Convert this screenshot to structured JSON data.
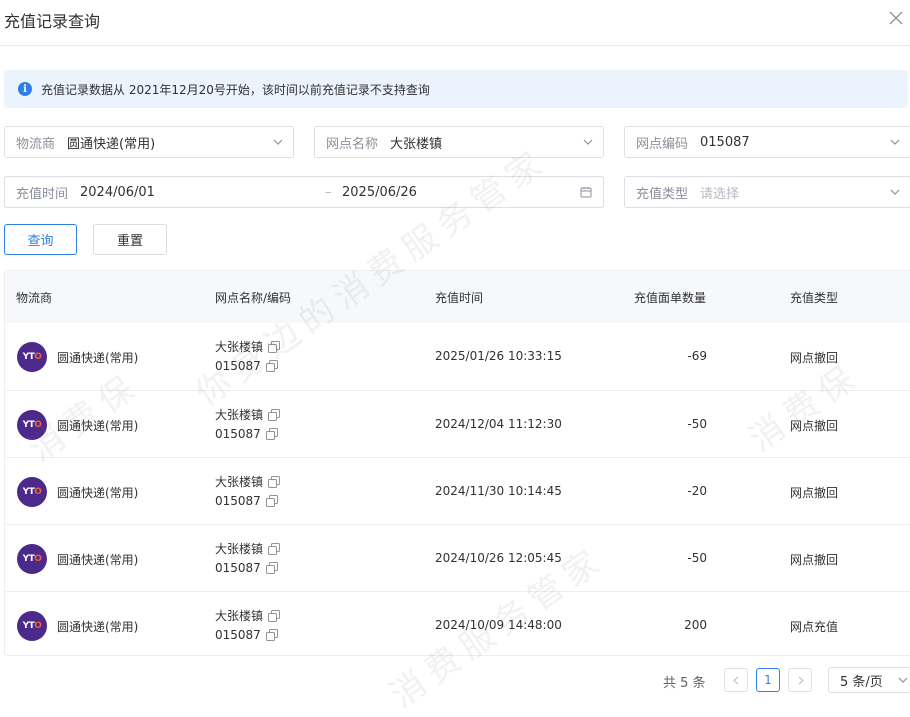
{
  "dialog": {
    "title": "充值记录查询"
  },
  "notice": {
    "text": "充值记录数据从 2021年12月20号开始，该时间以前充值记录不支持查询"
  },
  "filters": {
    "carrier": {
      "label": "物流商",
      "value": "圆通快递(常用)"
    },
    "site_name": {
      "label": "网点名称",
      "value": "大张楼镇"
    },
    "site_code": {
      "label": "网点编码",
      "value": "015087"
    },
    "time": {
      "label": "充值时间",
      "start": "2024/06/01",
      "separator": "–",
      "end": "2025/06/26"
    },
    "type": {
      "label": "充值类型",
      "placeholder": "请选择"
    }
  },
  "buttons": {
    "search": "查询",
    "reset": "重置"
  },
  "table": {
    "headers": [
      "物流商",
      "网点名称/编码",
      "充值时间",
      "充值面单数量",
      "充值类型"
    ],
    "rows": [
      {
        "logo": "YTO",
        "carrier": "圆通快递(常用)",
        "site_name": "大张楼镇",
        "site_code": "015087",
        "time": "2025/01/26 10:33:15",
        "qty": "-69",
        "type": "网点撤回"
      },
      {
        "logo": "YTO",
        "carrier": "圆通快递(常用)",
        "site_name": "大张楼镇",
        "site_code": "015087",
        "time": "2024/12/04 11:12:30",
        "qty": "-50",
        "type": "网点撤回"
      },
      {
        "logo": "YTO",
        "carrier": "圆通快递(常用)",
        "site_name": "大张楼镇",
        "site_code": "015087",
        "time": "2024/11/30 10:14:45",
        "qty": "-20",
        "type": "网点撤回"
      },
      {
        "logo": "YTO",
        "carrier": "圆通快递(常用)",
        "site_name": "大张楼镇",
        "site_code": "015087",
        "time": "2024/10/26 12:05:45",
        "qty": "-50",
        "type": "网点撤回"
      },
      {
        "logo": "YTO",
        "carrier": "圆通快递(常用)",
        "site_name": "大张楼镇",
        "site_code": "015087",
        "time": "2024/10/09 14:48:00",
        "qty": "200",
        "type": "网点充值"
      }
    ]
  },
  "pagination": {
    "total": "共 5 条",
    "current_page": "1",
    "page_size": "5 条/页"
  },
  "watermark": {
    "text_1": "你身边的消费服务管家",
    "text_2": "消费保",
    "text_3": "消费服务管家"
  },
  "colors": {
    "primary": "#2f7fe8",
    "notice_bg": "#ebf3fd",
    "logo_bg": "#4b2a8c"
  },
  "icons": {
    "close": "close-icon",
    "info": "info-icon",
    "dropdown": "chevron-down-icon",
    "calendar": "calendar-icon",
    "copy": "copy-icon",
    "prev": "chevron-left-icon",
    "next": "chevron-right-icon"
  }
}
